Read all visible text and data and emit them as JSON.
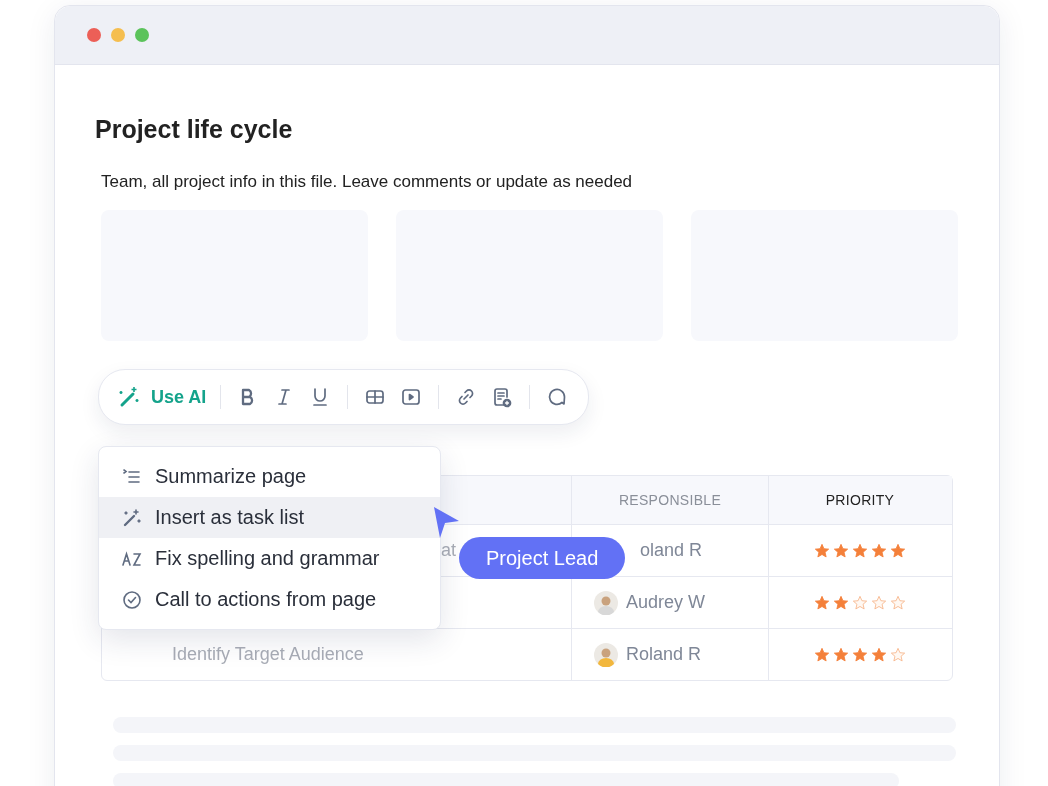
{
  "document": {
    "title": "Project life cycle",
    "description": "Team, all project info in this file. Leave comments or update as needed"
  },
  "toolbar": {
    "ai_label": "Use AI",
    "groups": [
      [
        {
          "kind": "bold"
        },
        {
          "kind": "italic"
        },
        {
          "kind": "underline"
        }
      ],
      [
        {
          "kind": "table"
        },
        {
          "kind": "video"
        }
      ],
      [
        {
          "kind": "link"
        },
        {
          "kind": "page-add"
        }
      ],
      [
        {
          "kind": "comment"
        }
      ]
    ]
  },
  "ai_menu": {
    "items": [
      {
        "kind": "summarize",
        "label": "Summarize page",
        "selected": false
      },
      {
        "kind": "magic",
        "label": "Insert as task list",
        "selected": true
      },
      {
        "kind": "az",
        "label": "Fix spelling and grammar",
        "selected": false
      },
      {
        "kind": "check",
        "label": "Call to actions from page",
        "selected": false
      }
    ]
  },
  "table": {
    "columns": [
      "RESPONSIBLE",
      "PRIORITY"
    ],
    "rows": [
      {
        "task": "at",
        "responsible": "oland R",
        "avatar": false,
        "stars": 5
      },
      {
        "responsible": "Audrey W",
        "avatar": true,
        "stars": 2
      },
      {
        "task": "Identify Target Audience",
        "responsible": "Roland R",
        "avatar": true,
        "stars": 4
      }
    ]
  },
  "badge": {
    "label": "Project Lead"
  }
}
